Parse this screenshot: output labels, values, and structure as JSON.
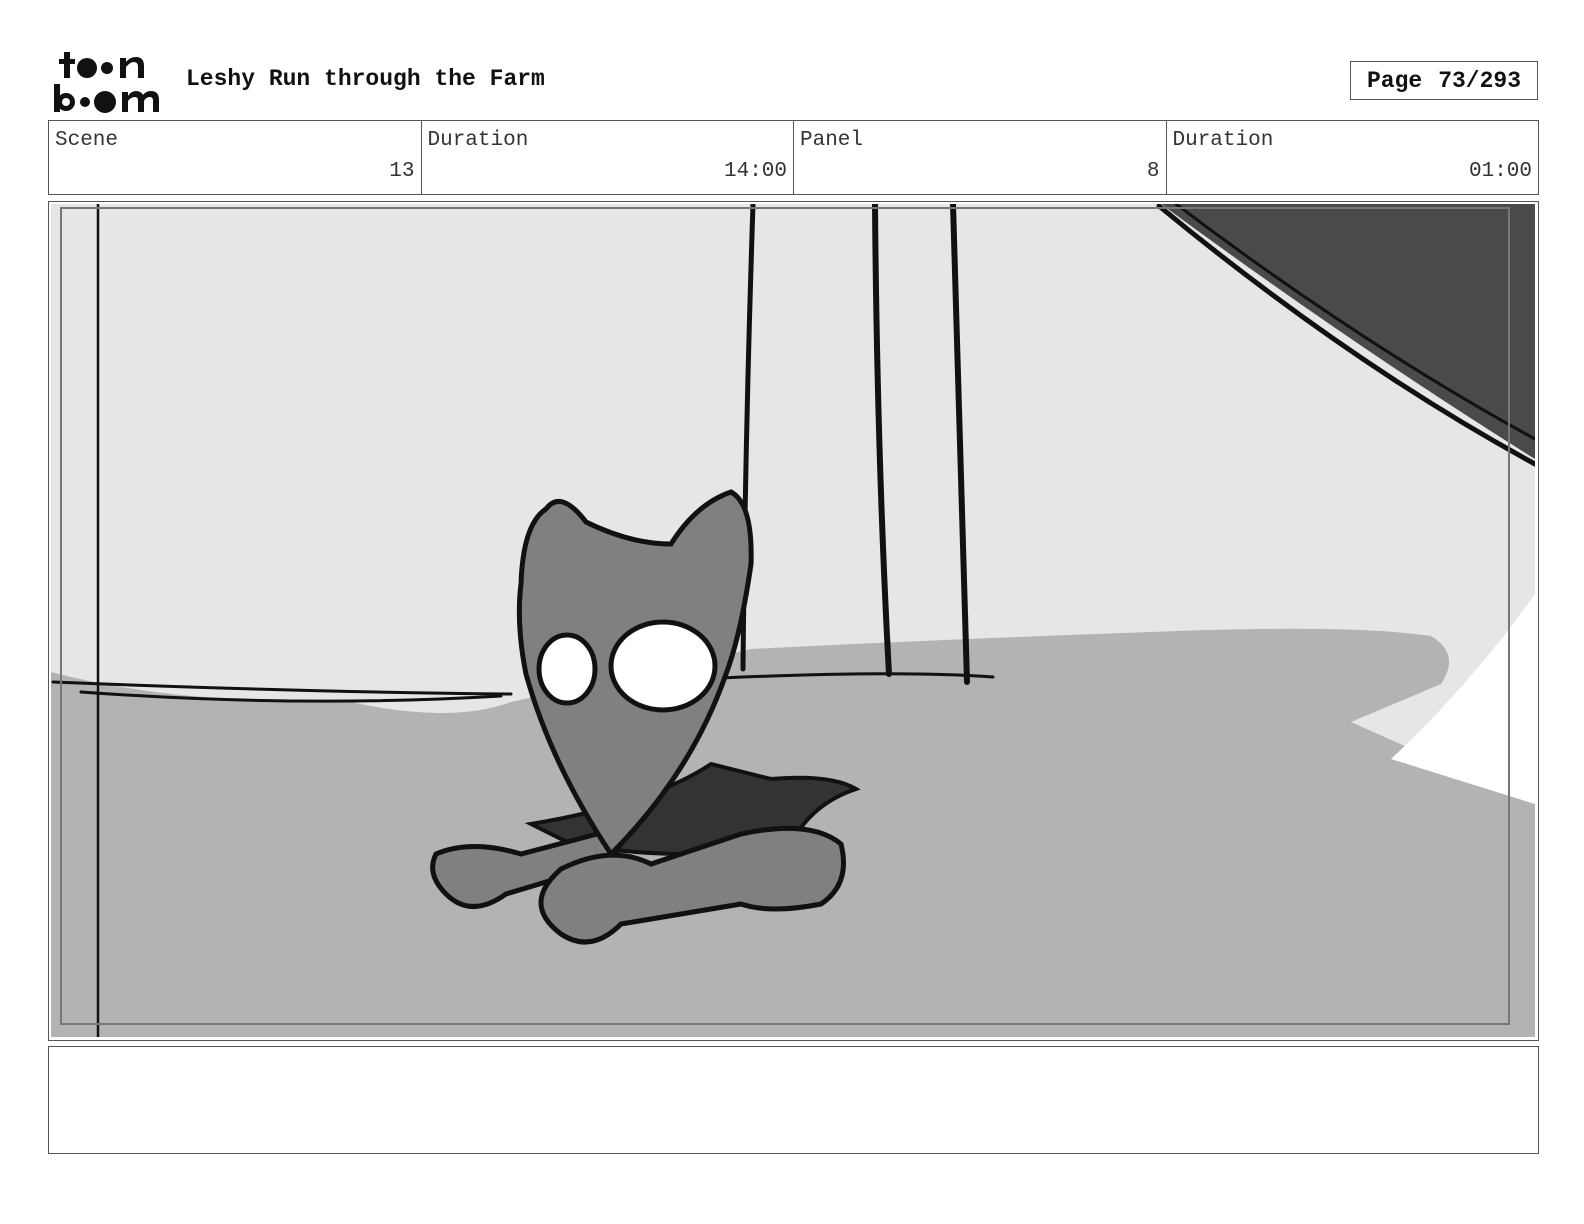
{
  "header": {
    "logo_text_line1": "toon",
    "logo_text_line2": "boom",
    "title": "Leshy Run through the Farm",
    "page_label": "Page",
    "page_number": "73/293"
  },
  "info": {
    "scene_label": "Scene",
    "scene_value": "13",
    "scene_duration_label": "Duration",
    "scene_duration_value": "14:00",
    "panel_label": "Panel",
    "panel_value": "8",
    "panel_duration_label": "Duration",
    "panel_duration_value": "01:00"
  },
  "notes": {
    "text": ""
  },
  "colors": {
    "sky": "#e6e6e6",
    "ground": "#b3b3b3",
    "dark": "#4a4a4a",
    "character": "#808080",
    "ink": "#111111"
  }
}
